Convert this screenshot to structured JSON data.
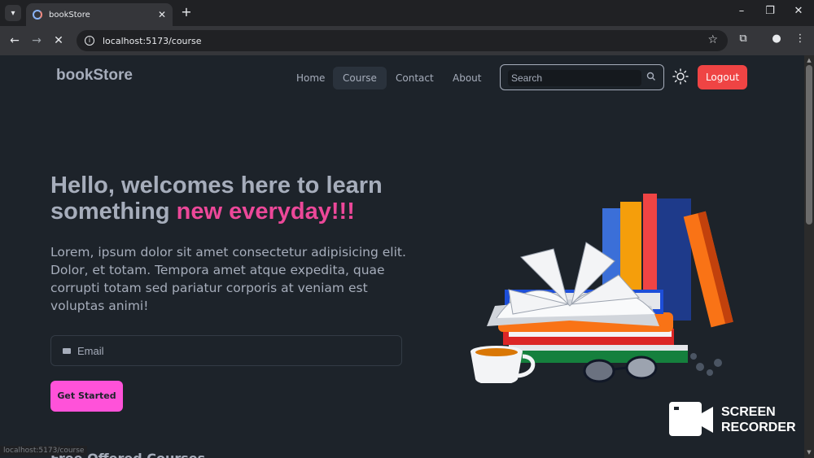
{
  "browser": {
    "tab_title": "bookStore",
    "url": "localhost:5173/course",
    "status_url": "localhost:5173/course"
  },
  "navbar": {
    "logo": "bookStore",
    "links": [
      "Home",
      "Course",
      "Contact",
      "About"
    ],
    "active_link": "Course",
    "search_placeholder": "Search",
    "logout_label": "Logout"
  },
  "hero": {
    "title_plain": "Hello, welcomes here to learn something ",
    "title_highlight": "new everyday!!!",
    "description": "Lorem, ipsum dolor sit amet consectetur adipisicing elit. Dolor, et totam. Tempora amet atque expedita, quae corrupti totam sed pariatur corporis at veniam est voluptas animi!",
    "email_placeholder": "Email",
    "cta_label": "Get Started"
  },
  "section": {
    "heading": "Free Offered Courses"
  },
  "watermark": {
    "line1": "SCREEN",
    "line2": "RECORDER"
  },
  "colors": {
    "background": "#1d232a",
    "text": "#a6adbb",
    "accent_pink": "#ec4899",
    "logout_red": "#ef4444",
    "cta_pink": "#ff52d9"
  }
}
